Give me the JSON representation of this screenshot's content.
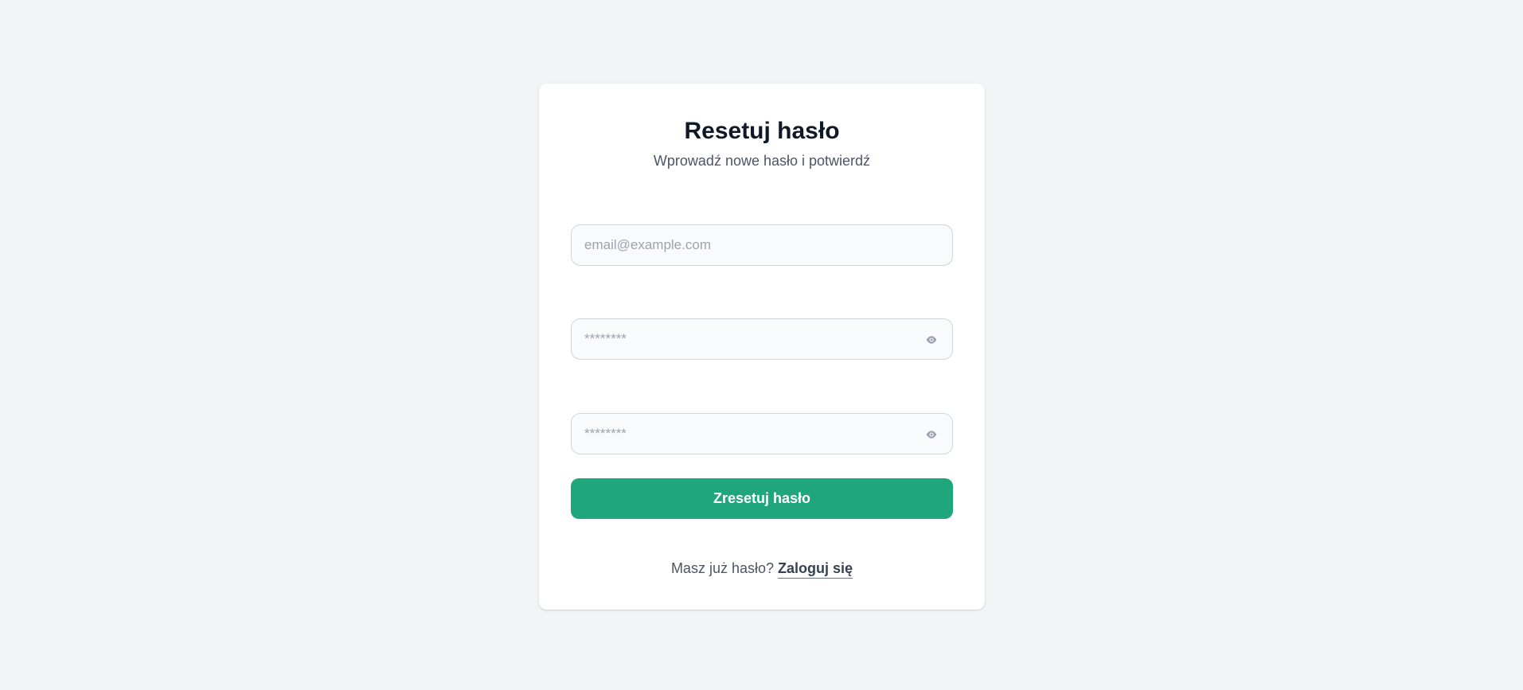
{
  "reset_form": {
    "title": "Resetuj hasło",
    "subtitle": "Wprowadź nowe hasło i potwierdź",
    "email_field": {
      "value": "",
      "placeholder": "email@example.com"
    },
    "password_field": {
      "value": "",
      "placeholder": "********",
      "toggle_icon": "eye-icon"
    },
    "confirm_password_field": {
      "value": "",
      "placeholder": "********",
      "toggle_icon": "eye-icon"
    },
    "submit_label": "Zresetuj hasło",
    "footer_text": "Masz już hasło?",
    "login_link_label": "Zaloguj się"
  },
  "colors": {
    "background": "#f3f4f6",
    "card": "#ffffff",
    "accent": "#1fa67a",
    "title": "#111827"
  }
}
